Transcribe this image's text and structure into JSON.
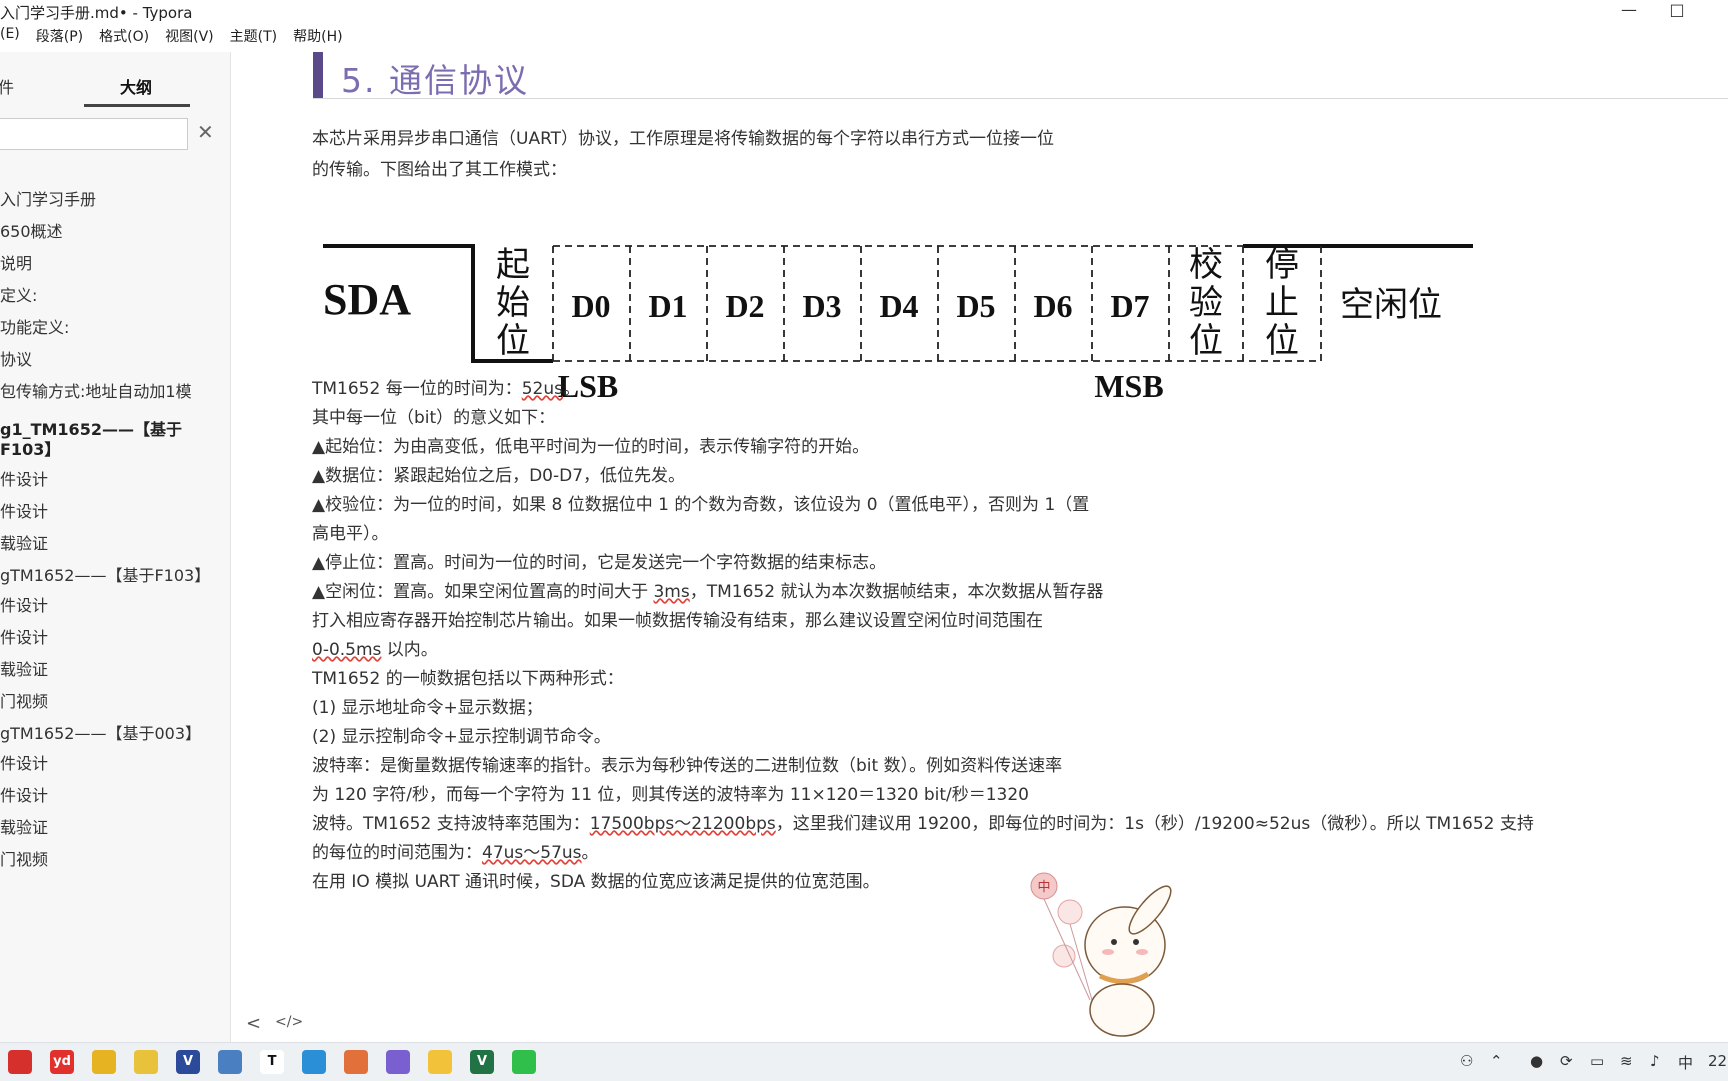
{
  "window": {
    "title": "入门学习手册.md• - Typora",
    "minimize": "—",
    "maximize": "□"
  },
  "menu": [
    "(E)",
    "段落(P)",
    "格式(O)",
    "视图(V)",
    "主题(T)",
    "帮助(H)"
  ],
  "sidebar": {
    "tab_files": "件",
    "tab_outline": "大纲",
    "close": "✕",
    "items": [
      {
        "label": "入门学习手册",
        "type": "h1"
      },
      {
        "label": "650概述",
        "type": "item"
      },
      {
        "label": "说明",
        "type": "item"
      },
      {
        "label": "定义:",
        "type": "item"
      },
      {
        "label": "功能定义:",
        "type": "item"
      },
      {
        "label": "协议",
        "type": "item"
      },
      {
        "label": "包传输方式:地址自动加1模",
        "type": "item"
      },
      {
        "label": "g1_TM1652——【基于F103】",
        "type": "h2"
      },
      {
        "label": "件设计",
        "type": "item"
      },
      {
        "label": "件设计",
        "type": "item"
      },
      {
        "label": "载验证",
        "type": "item"
      },
      {
        "label": "gTM1652——【基于F103】",
        "type": "h2n"
      },
      {
        "label": "件设计",
        "type": "item"
      },
      {
        "label": "件设计",
        "type": "item"
      },
      {
        "label": "载验证",
        "type": "item"
      },
      {
        "label": "门视频",
        "type": "item"
      },
      {
        "label": "gTM1652——【基于003】",
        "type": "h2n"
      },
      {
        "label": "件设计",
        "type": "item"
      },
      {
        "label": "件设计",
        "type": "item"
      },
      {
        "label": "载验证",
        "type": "item"
      },
      {
        "label": "门视频",
        "type": "item"
      }
    ]
  },
  "main": {
    "heading": "5.  通信协议",
    "intro1": "本芯片采用异步串口通信（UART）协议，工作原理是将传输数据的每个字符以串行方式一位接一位",
    "intro2": "的传输。下图给出了其工作模式：",
    "diagram": {
      "signal": "SDA",
      "start": [
        "起",
        "始",
        "位"
      ],
      "bits": [
        "D0",
        "D1",
        "D2",
        "D3",
        "D4",
        "D5",
        "D6",
        "D7"
      ],
      "parity": [
        "校",
        "验",
        "位"
      ],
      "stop": [
        "停",
        "止",
        "位"
      ],
      "idle": "空闲位",
      "lsb": "LSB",
      "msb": "MSB"
    },
    "lines": [
      {
        "pre": "TM1652 每一位的时间为：",
        "u": "52us",
        "post": "。"
      },
      {
        "pre": "其中每一位（bit）的意义如下：",
        "u": "",
        "post": ""
      },
      {
        "pre": "▲起始位：为由高变低，低电平时间为一位的时间，表示传输字符的开始。",
        "u": "",
        "post": ""
      },
      {
        "pre": "▲数据位：紧跟起始位之后，D0-D7，低位先发。",
        "u": "",
        "post": ""
      },
      {
        "pre": "▲校验位：为一位的时间，如果 8 位数据位中 1 的个数为奇数，该位设为 0（置低电平），否则为 1（置",
        "u": "",
        "post": ""
      },
      {
        "pre": "高电平）。",
        "u": "",
        "post": ""
      },
      {
        "pre": "▲停止位：置高。时间为一位的时间，它是发送完一个字符数据的结束标志。",
        "u": "",
        "post": ""
      },
      {
        "pre": "▲空闲位：置高。如果空闲位置高的时间大于 ",
        "u": "3ms",
        "post": "，TM1652 就认为本次数据帧结束，本次数据从暂存器"
      },
      {
        "pre": "打入相应寄存器开始控制芯片输出。如果一帧数据传输没有结束，那么建议设置空闲位时间范围在",
        "u": "",
        "post": ""
      },
      {
        "pre": "",
        "u": "0-0.5ms",
        "post": " 以内。"
      },
      {
        "pre": "TM1652 的一帧数据包括以下两种形式：",
        "u": "",
        "post": ""
      },
      {
        "pre": "(1) 显示地址命令+显示数据；",
        "u": "",
        "post": ""
      },
      {
        "pre": "(2) 显示控制命令+显示控制调节命令。",
        "u": "",
        "post": ""
      },
      {
        "pre": "波特率：是衡量数据传输速率的指针。表示为每秒钟传送的二进制位数（bit 数）。例如资料传送速率",
        "u": "",
        "post": ""
      },
      {
        "pre": "为 120 字符/秒，而每一个字符为 11 位，则其传送的波特率为 11×120＝1320 bit/秒＝1320",
        "u": "",
        "post": ""
      },
      {
        "pre": "波特。TM1652 支持波特率范围为：",
        "u": "17500bps～21200bps",
        "post": "，这里我们建议用 19200，即每位的时间为：1s（秒）/19200≈52us（微秒）。所以 TM1652 支持"
      },
      {
        "pre": "的每位的时间范围为：",
        "u": "47us～57us",
        "post": "。"
      },
      {
        "pre": "在用 IO 模拟 UART 通讯时候，SDA 数据的位宽应该满足提供的位宽范围。",
        "u": "",
        "post": ""
      }
    ]
  },
  "editor_footer": {
    "back": "<",
    "source": "</>"
  },
  "taskbar": {
    "apps": [
      {
        "name": "app-red",
        "label": "",
        "color": "#d6302d"
      },
      {
        "name": "youdao",
        "label": "yd",
        "color": "#e2312d"
      },
      {
        "name": "app-yellow",
        "label": "",
        "color": "#e6b422"
      },
      {
        "name": "app-yellow2",
        "label": "",
        "color": "#e8c23a"
      },
      {
        "name": "vivado",
        "label": "V",
        "color": "#2c4a9a"
      },
      {
        "name": "app-net",
        "label": "",
        "color": "#4a7fc1"
      },
      {
        "name": "typora",
        "label": "T",
        "color": "#ffffff"
      },
      {
        "name": "app-blue",
        "label": "",
        "color": "#2a8fd6"
      },
      {
        "name": "app-orange",
        "label": "",
        "color": "#e2703a"
      },
      {
        "name": "app-purple",
        "label": "",
        "color": "#7a5fd1"
      },
      {
        "name": "file-explorer",
        "label": "",
        "color": "#f2c23a"
      },
      {
        "name": "excel-like",
        "label": "V",
        "color": "#217346"
      },
      {
        "name": "wechat",
        "label": "",
        "color": "#2fbf4a"
      }
    ],
    "ime": "中",
    "time": "22"
  },
  "mascot": {
    "balloon": "中"
  }
}
